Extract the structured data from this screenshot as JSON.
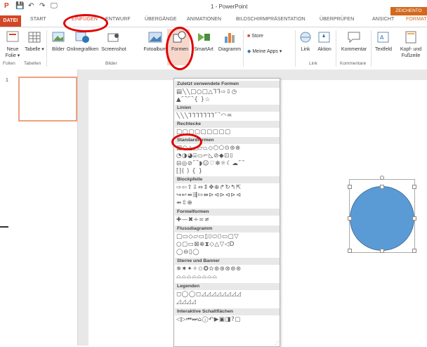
{
  "app": {
    "document_title": "1 - PowerPoint",
    "context_tab": "ZEICHENTO"
  },
  "quick_access": [
    "P",
    "💾",
    "↶",
    "↷",
    "🖵"
  ],
  "tabs": [
    "DATEI",
    "START",
    "EINFÜGEN",
    "ENTWURF",
    "ÜBERGÄNGE",
    "ANIMATIONEN",
    "BILDSCHIRMPRÄSENTATION",
    "ÜBERPRÜFEN",
    "ANSICHT",
    "FORMAT"
  ],
  "ribbon": {
    "neue_folie": "Neue Folie ▾",
    "tabelle": "Tabelle ▾",
    "bilder": "Bilder",
    "onlinegrafiken": "Onlinegrafiken",
    "screenshot": "Screenshot",
    "fotoalbum": "Fotoalbum",
    "formen": "Formen",
    "smartart": "SmartArt",
    "diagramm": "Diagramm",
    "store": "Store",
    "meine_apps": "Meine Apps ▾",
    "link": "Link",
    "aktion": "Aktion",
    "kommentar": "Kommentar",
    "textfeld": "Textfeld",
    "kopf_und_fusszeile": "Kopf- und Fußzeile",
    "groups": {
      "folien": "Folien",
      "tabellen": "Tabellen",
      "bilder": "Bilder",
      "link": "Link",
      "kommentare": "Kommentare"
    }
  },
  "thumbnail": {
    "number": "1"
  },
  "shapes_menu": {
    "sections": [
      {
        "title": "Zuletzt verwendete Formen",
        "rows": [
          "▤╲╲□○□△⅂⅂⇨⇩◷",
          "▲⌒⌒{ }☆"
        ]
      },
      {
        "title": "Linien",
        "rows": [
          "╲╲╲⅂⅂⅂⅂⅂⅂⅂⌒◠♒"
        ]
      },
      {
        "title": "Rechtecke",
        "rows": [
          "□▢▢▢▢▢▢▢▢"
        ]
      },
      {
        "title": "Standardformen",
        "rows": [
          "▤○△◿▱⏢◇⬡⬠⊙⊛⊗",
          "◔◑◕⌸▭⌐◺⊘◆⊡⌷",
          "⊟◎⊘⌒◗☺♡✻☼☾☁⌒",
          "⁅⁆( ) { }"
        ]
      },
      {
        "title": "Blockpfeile",
        "rows": [
          "⇨⇦⇧⇩⇔⇕✥⊕↱↻↰⇱",
          "↪↩⇴⇶⇰⇻⊳⊲⊳⊲⊳⊲",
          "⇴⇳⊕"
        ]
      },
      {
        "title": "Formelformen",
        "rows": [
          "✚—✖÷=≠"
        ]
      },
      {
        "title": "Flussdiagramm",
        "rows": [
          "□▭◇▱▭▯⌷⬭⬯▭▢▽",
          "○▢▭⊠⊕⧗◇△▽◁D",
          "◯⊖▯◯"
        ]
      },
      {
        "title": "Sterne und Banner",
        "rows": [
          "✵✷✦✧✩✪✫⊛⊛⊛⊛⊛",
          "⌓⌓⌓⌓⌓⌓⌓⌓"
        ]
      },
      {
        "title": "Legenden",
        "rows": [
          "◻◯◯◻◿◿◿◿◿◿◿◿",
          "◿◿◿◿"
        ]
      },
      {
        "title": "Interaktive Schaltflächen",
        "rows": [
          "◁▷⏮⏭⌂ⓘ↶▶▣◨?▢"
        ]
      }
    ]
  },
  "colors": {
    "accent": "#d24726",
    "highlight": "#f7d7cc",
    "shape_fill": "#5b9bd5",
    "annotation": "#e00000"
  }
}
